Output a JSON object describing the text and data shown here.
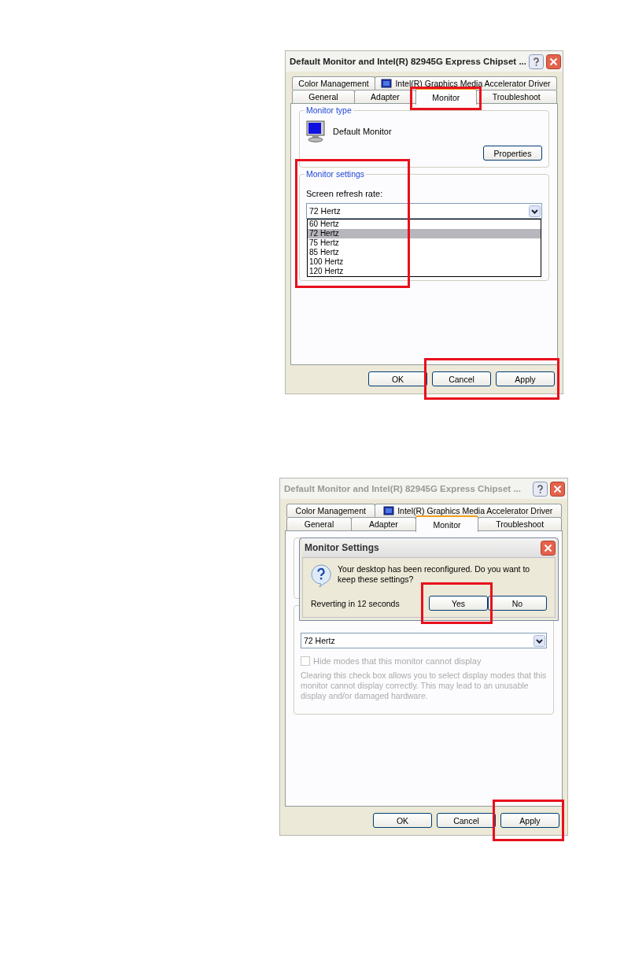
{
  "screens": [
    {
      "window": {
        "title": "Default Monitor and Intel(R) 82945G Express Chipset ...",
        "active": true
      },
      "tab_rows": [
        {
          "tabs": [
            {
              "label": "Color Management",
              "kind": "plain",
              "selected": false,
              "highlighted": false
            },
            {
              "label": "Intel(R) Graphics Media Accelerator Driver",
              "kind": "driver",
              "selected": false,
              "highlighted": false
            }
          ]
        },
        {
          "tabs": [
            {
              "label": "General",
              "kind": "plain",
              "selected": false,
              "highlighted": false
            },
            {
              "label": "Adapter",
              "kind": "plain",
              "selected": false,
              "highlighted": false
            },
            {
              "label": "Monitor",
              "kind": "plain",
              "selected": true,
              "highlighted": true
            },
            {
              "label": "Troubleshoot",
              "kind": "plain",
              "selected": false,
              "highlighted": false
            }
          ]
        }
      ],
      "monitor_type": {
        "title": "Monitor type",
        "name": "Default Monitor",
        "button": "Properties"
      },
      "monitor_settings": {
        "title": "Monitor settings",
        "label": "Screen refresh rate:",
        "value": "72 Hertz",
        "highlighted": true,
        "expanded": true,
        "options": [
          {
            "label": "60 Hertz",
            "selected": false
          },
          {
            "label": "72 Hertz",
            "selected": true
          },
          {
            "label": "75 Hertz",
            "selected": false
          },
          {
            "label": "85 Hertz",
            "selected": false
          },
          {
            "label": "100 Hertz",
            "selected": false
          },
          {
            "label": "120 Hertz",
            "selected": false
          }
        ]
      },
      "buttons": [
        {
          "label": "OK",
          "highlighted": false
        },
        {
          "label": "Cancel",
          "highlighted": true
        },
        {
          "label": "Apply",
          "highlighted": true
        }
      ]
    },
    {
      "window": {
        "title": "Default Monitor and Intel(R) 82945G Express Chipset ...",
        "active": false
      },
      "tab_rows": [
        {
          "tabs": [
            {
              "label": "Color Management",
              "kind": "plain",
              "selected": false,
              "highlighted": false
            },
            {
              "label": "Intel(R) Graphics Media Accelerator Driver",
              "kind": "driver",
              "selected": false,
              "highlighted": false
            }
          ]
        },
        {
          "tabs": [
            {
              "label": "General",
              "kind": "plain",
              "selected": false,
              "highlighted": false
            },
            {
              "label": "Adapter",
              "kind": "plain",
              "selected": false,
              "highlighted": false
            },
            {
              "label": "Monitor",
              "kind": "plain",
              "selected": true,
              "highlighted": false
            },
            {
              "label": "Troubleshoot",
              "kind": "plain",
              "selected": false,
              "highlighted": false
            }
          ]
        }
      ],
      "monitor_settings": {
        "value": "72 Hertz",
        "highlighted": false,
        "expanded": false,
        "checkbox": {
          "label": "Hide modes that this monitor cannot display",
          "checked": false,
          "disabled": true
        },
        "note": "Clearing this check box allows you to select display modes that this monitor cannot display correctly. This may lead to an unusable display and/or damaged hardware."
      },
      "popup": {
        "title": "Monitor Settings",
        "message": "Your desktop has been reconfigured.  Do you want to keep these settings?",
        "countdown": "Reverting in 12 seconds",
        "buttons": [
          {
            "label": "Yes",
            "highlighted": true
          },
          {
            "label": "No",
            "highlighted": false
          }
        ]
      },
      "buttons": [
        {
          "label": "OK",
          "highlighted": false
        },
        {
          "label": "Cancel",
          "highlighted": false
        },
        {
          "label": "Apply",
          "highlighted": true
        }
      ]
    }
  ]
}
